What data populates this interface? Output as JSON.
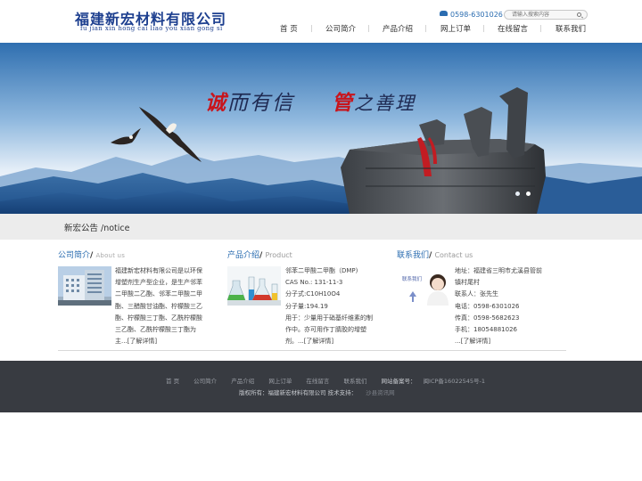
{
  "header": {
    "logo_cn": "福建新宏材料有限公司",
    "logo_en": "fu jian xin hong cai liao you xian gong si",
    "phone": "0598-6301026",
    "search_placeholder": "请输入搜索内容"
  },
  "nav": [
    "首 页",
    "公司简介",
    "产品介绍",
    "网上订单",
    "在线留言",
    "联系我们"
  ],
  "banner": {
    "slogan_1a": "诚",
    "slogan_1b": "而有信",
    "slogan_2a": "管",
    "slogan_2b": "之善理"
  },
  "notice": "新宏公告 /notice",
  "about": {
    "title_cn": "公司简介",
    "title_en": "About us",
    "body": "福建新宏材料有限公司是以环保增塑剂生产型企业，是生产邻苯二甲酸二乙酯、邻苯二甲酸二甲酯、三醋酸甘油酯、柠檬酸三乙酯、柠檬酸三丁酯、乙酰柠檬酸三乙酯、乙酰柠檬酸三丁酯为主...",
    "more": "[了解详情]"
  },
  "product": {
    "title_cn": "产品介绍",
    "title_en": "Product",
    "lines": [
      "邻苯二甲酸二甲酯（DMP)",
      "CAS No.: 131-11-3",
      "分子式:C10H10O4",
      "分子量:194.19",
      "用于：少量用于硝基纤维素的制",
      "作中。亦可用作丁腈胶的增塑",
      "剂。..."
    ],
    "more": "[了解详情]"
  },
  "contact": {
    "title_cn": "联系我们",
    "title_en": "Contact us",
    "img_label": "联系我们",
    "lines": [
      "地址：福建省三明市尤溪县管前",
      "镇村尾村",
      "联系人：张先生",
      "电话：0598-6301026",
      "传真：0598-5682623",
      "手机：18054881026",
      "..."
    ],
    "more": "[了解详情]"
  },
  "footer": {
    "links": [
      "首 页",
      "公司简介",
      "产品介绍",
      "网上订单",
      "在线留言",
      "联系我们"
    ],
    "icp_label": "网站备案号：",
    "icp": "闽ICP备16022545号-1",
    "copyright": "版权所有：福建新宏材料有限公司  技术支持：",
    "tech": "沙县资讯网"
  },
  "colors": {
    "accent": "#2a6cb0",
    "logo": "#1d3f8f",
    "slogan_red": "#c8141c",
    "footer_bg": "#383b41",
    "notice_bg": "#ececec"
  }
}
